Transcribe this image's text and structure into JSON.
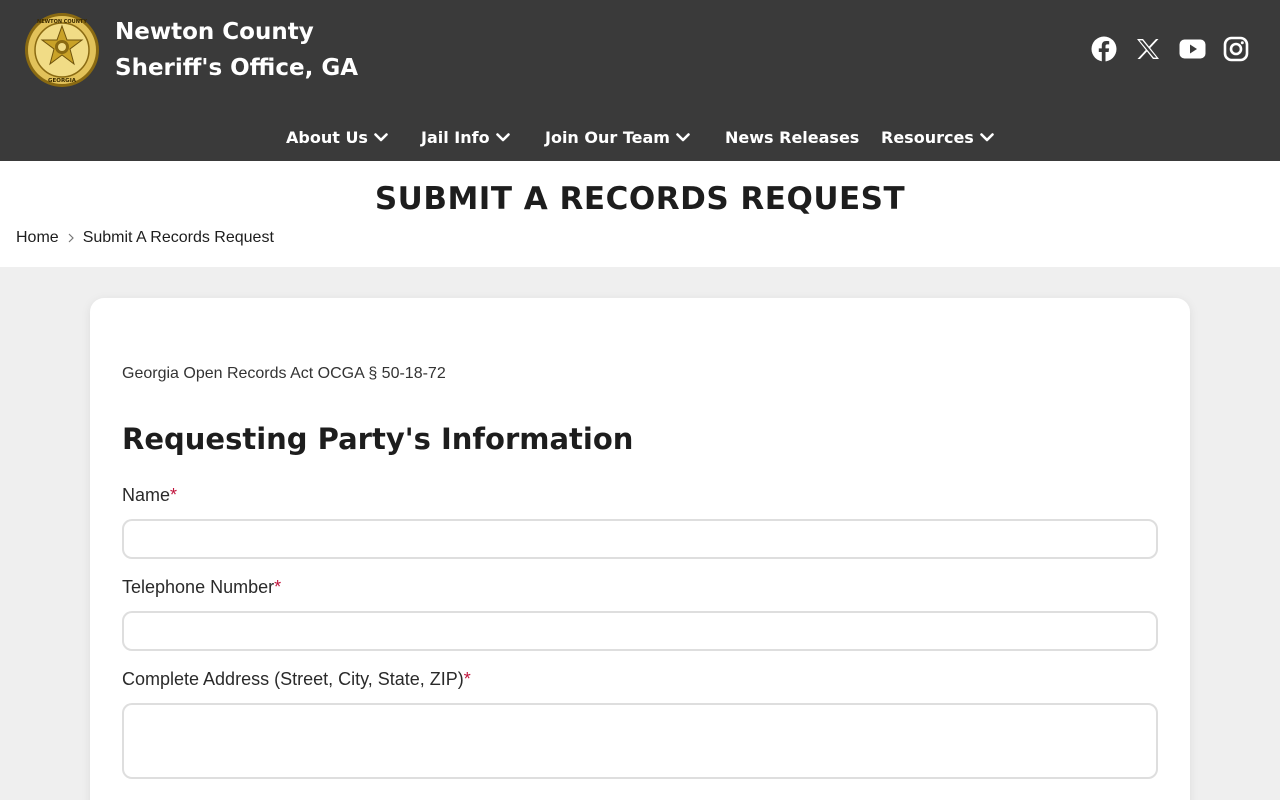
{
  "header": {
    "title_line1": "Newton County",
    "title_line2": "Sheriff's Office, GA",
    "logo_text": "NEWTON COUNTY SHERIFF GEORGIA",
    "social": [
      "facebook-icon",
      "x-icon",
      "youtube-icon",
      "instagram-icon"
    ]
  },
  "nav": {
    "items": [
      {
        "label": "About Us",
        "dropdown": true
      },
      {
        "label": "Jail Info",
        "dropdown": true
      },
      {
        "label": "Join Our Team",
        "dropdown": true
      },
      {
        "label": "News Releases",
        "dropdown": false
      },
      {
        "label": "Resources",
        "dropdown": true
      }
    ]
  },
  "page": {
    "title": "SUBMIT A RECORDS REQUEST",
    "breadcrumb": {
      "home": "Home",
      "current": "Submit A Records Request"
    }
  },
  "form": {
    "intro": "Georgia Open Records Act OCGA § 50-18-72",
    "heading": "Requesting Party's Information",
    "required_mark": "*",
    "fields": [
      {
        "label": "Name",
        "value": ""
      },
      {
        "label": "Telephone Number",
        "value": ""
      },
      {
        "label": "Complete Address (Street, City, State, ZIP)",
        "value": ""
      }
    ]
  },
  "colors": {
    "header_bg": "#3a3a3a",
    "page_bg": "#efefef",
    "required": "#c0143c",
    "badge_gold": "#c9a227"
  }
}
